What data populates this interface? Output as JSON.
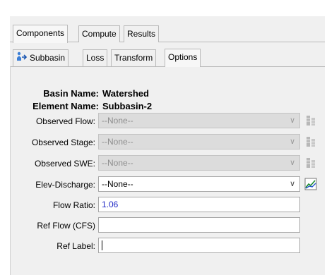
{
  "outer_tabs": [
    {
      "label": "Components",
      "active": true
    },
    {
      "label": "Compute",
      "active": false
    },
    {
      "label": "Results",
      "active": false
    }
  ],
  "inner_tabs": [
    {
      "label": "Subbasin",
      "icon": "subbasin-icon",
      "active": false
    },
    {
      "label": "Loss",
      "active": false
    },
    {
      "label": "Transform",
      "active": false
    },
    {
      "label": "Options",
      "active": true
    }
  ],
  "basin": {
    "label": "Basin Name:",
    "value": "Watershed"
  },
  "element": {
    "label": "Element Name:",
    "value": "Subbasin-2"
  },
  "fields": {
    "observed_flow": {
      "label": "Observed Flow:",
      "value": "--None--",
      "enabled": false
    },
    "observed_stage": {
      "label": "Observed Stage:",
      "value": "--None--",
      "enabled": false
    },
    "observed_swe": {
      "label": "Observed SWE:",
      "value": "--None--",
      "enabled": false
    },
    "elev_discharge": {
      "label": "Elev-Discharge:",
      "value": "--None--",
      "enabled": true
    },
    "flow_ratio": {
      "label": "Flow Ratio:",
      "value": "1.06"
    },
    "ref_flow": {
      "label": "Ref Flow (CFS)",
      "value": ""
    },
    "ref_label": {
      "label": "Ref Label:",
      "value": ""
    }
  },
  "icons": {
    "chevron": "∨",
    "gage": "gage-icon",
    "graph": "graph-icon"
  },
  "colors": {
    "number_text": "#1f28c6",
    "disabled_field": "#dcdcdc",
    "graph_green": "#1a8a2e",
    "graph_blue": "#2255cc"
  }
}
